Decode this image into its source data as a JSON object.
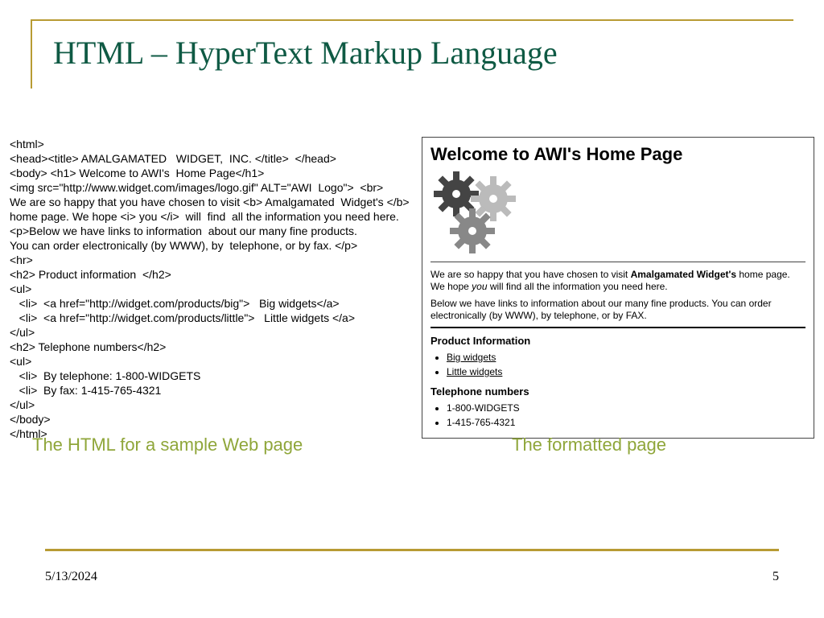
{
  "title": "HTML – HyperText Markup Language",
  "src": {
    "l1": "<html>",
    "l2": "<head><title> AMALGAMATED   WIDGET,  INC. </title>  </head>",
    "l3": "<body> <h1> Welcome to AWI's  Home Page</h1>",
    "l4": "<img src=\"http://www.widget.com/images/logo.gif\" ALT=\"AWI  Logo\">  <br>",
    "l5": "We are so happy that you have chosen to visit <b> Amalgamated  Widget's </b>",
    "l6": "home page. We hope <i> you </i>  will  find  all the information you need here.",
    "l7": "<p>Below we have links to information  about our many fine products.",
    "l8": "You can order electronically (by WWW), by  telephone, or by fax. </p>",
    "l9": "<hr>",
    "l10": "<h2> Product information  </h2>",
    "l11": "<ul>",
    "l12": "   <li>  <a href=\"http://widget.com/products/big\">   Big widgets</a>",
    "l13": "   <li>  <a href=\"http://widget.com/products/little\">   Little widgets </a>",
    "l14": "</ul>",
    "l15": "<h2> Telephone numbers</h2>",
    "l16": "<ul>",
    "l17": "   <li>  By telephone: 1-800-WIDGETS",
    "l18": "   <li>  By fax: 1-415-765-4321",
    "l19": "</ul>",
    "l20": "</body>",
    "l21": "</html>"
  },
  "page": {
    "h1": "Welcome to AWI's Home Page",
    "p1_a": "We are so happy that you have chosen to visit ",
    "p1_b": "Amalgamated Widget's",
    "p1_c": " home page. We hope ",
    "p1_d": "you",
    "p1_e": " will find all the information you need here.",
    "p2": "Below  we have links to information about our many fine products. You can order electronically (by WWW), by telephone, or by FAX.",
    "h2a": "Product Information",
    "link1": "Big widgets",
    "link2": "Little widgets",
    "h2b": "Telephone numbers",
    "tel1": "1-800-WIDGETS",
    "tel2": "1-415-765-4321"
  },
  "captions": {
    "left": "The HTML for a sample Web page",
    "right": "The formatted page"
  },
  "footer": {
    "date": "5/13/2024",
    "page": "5"
  }
}
